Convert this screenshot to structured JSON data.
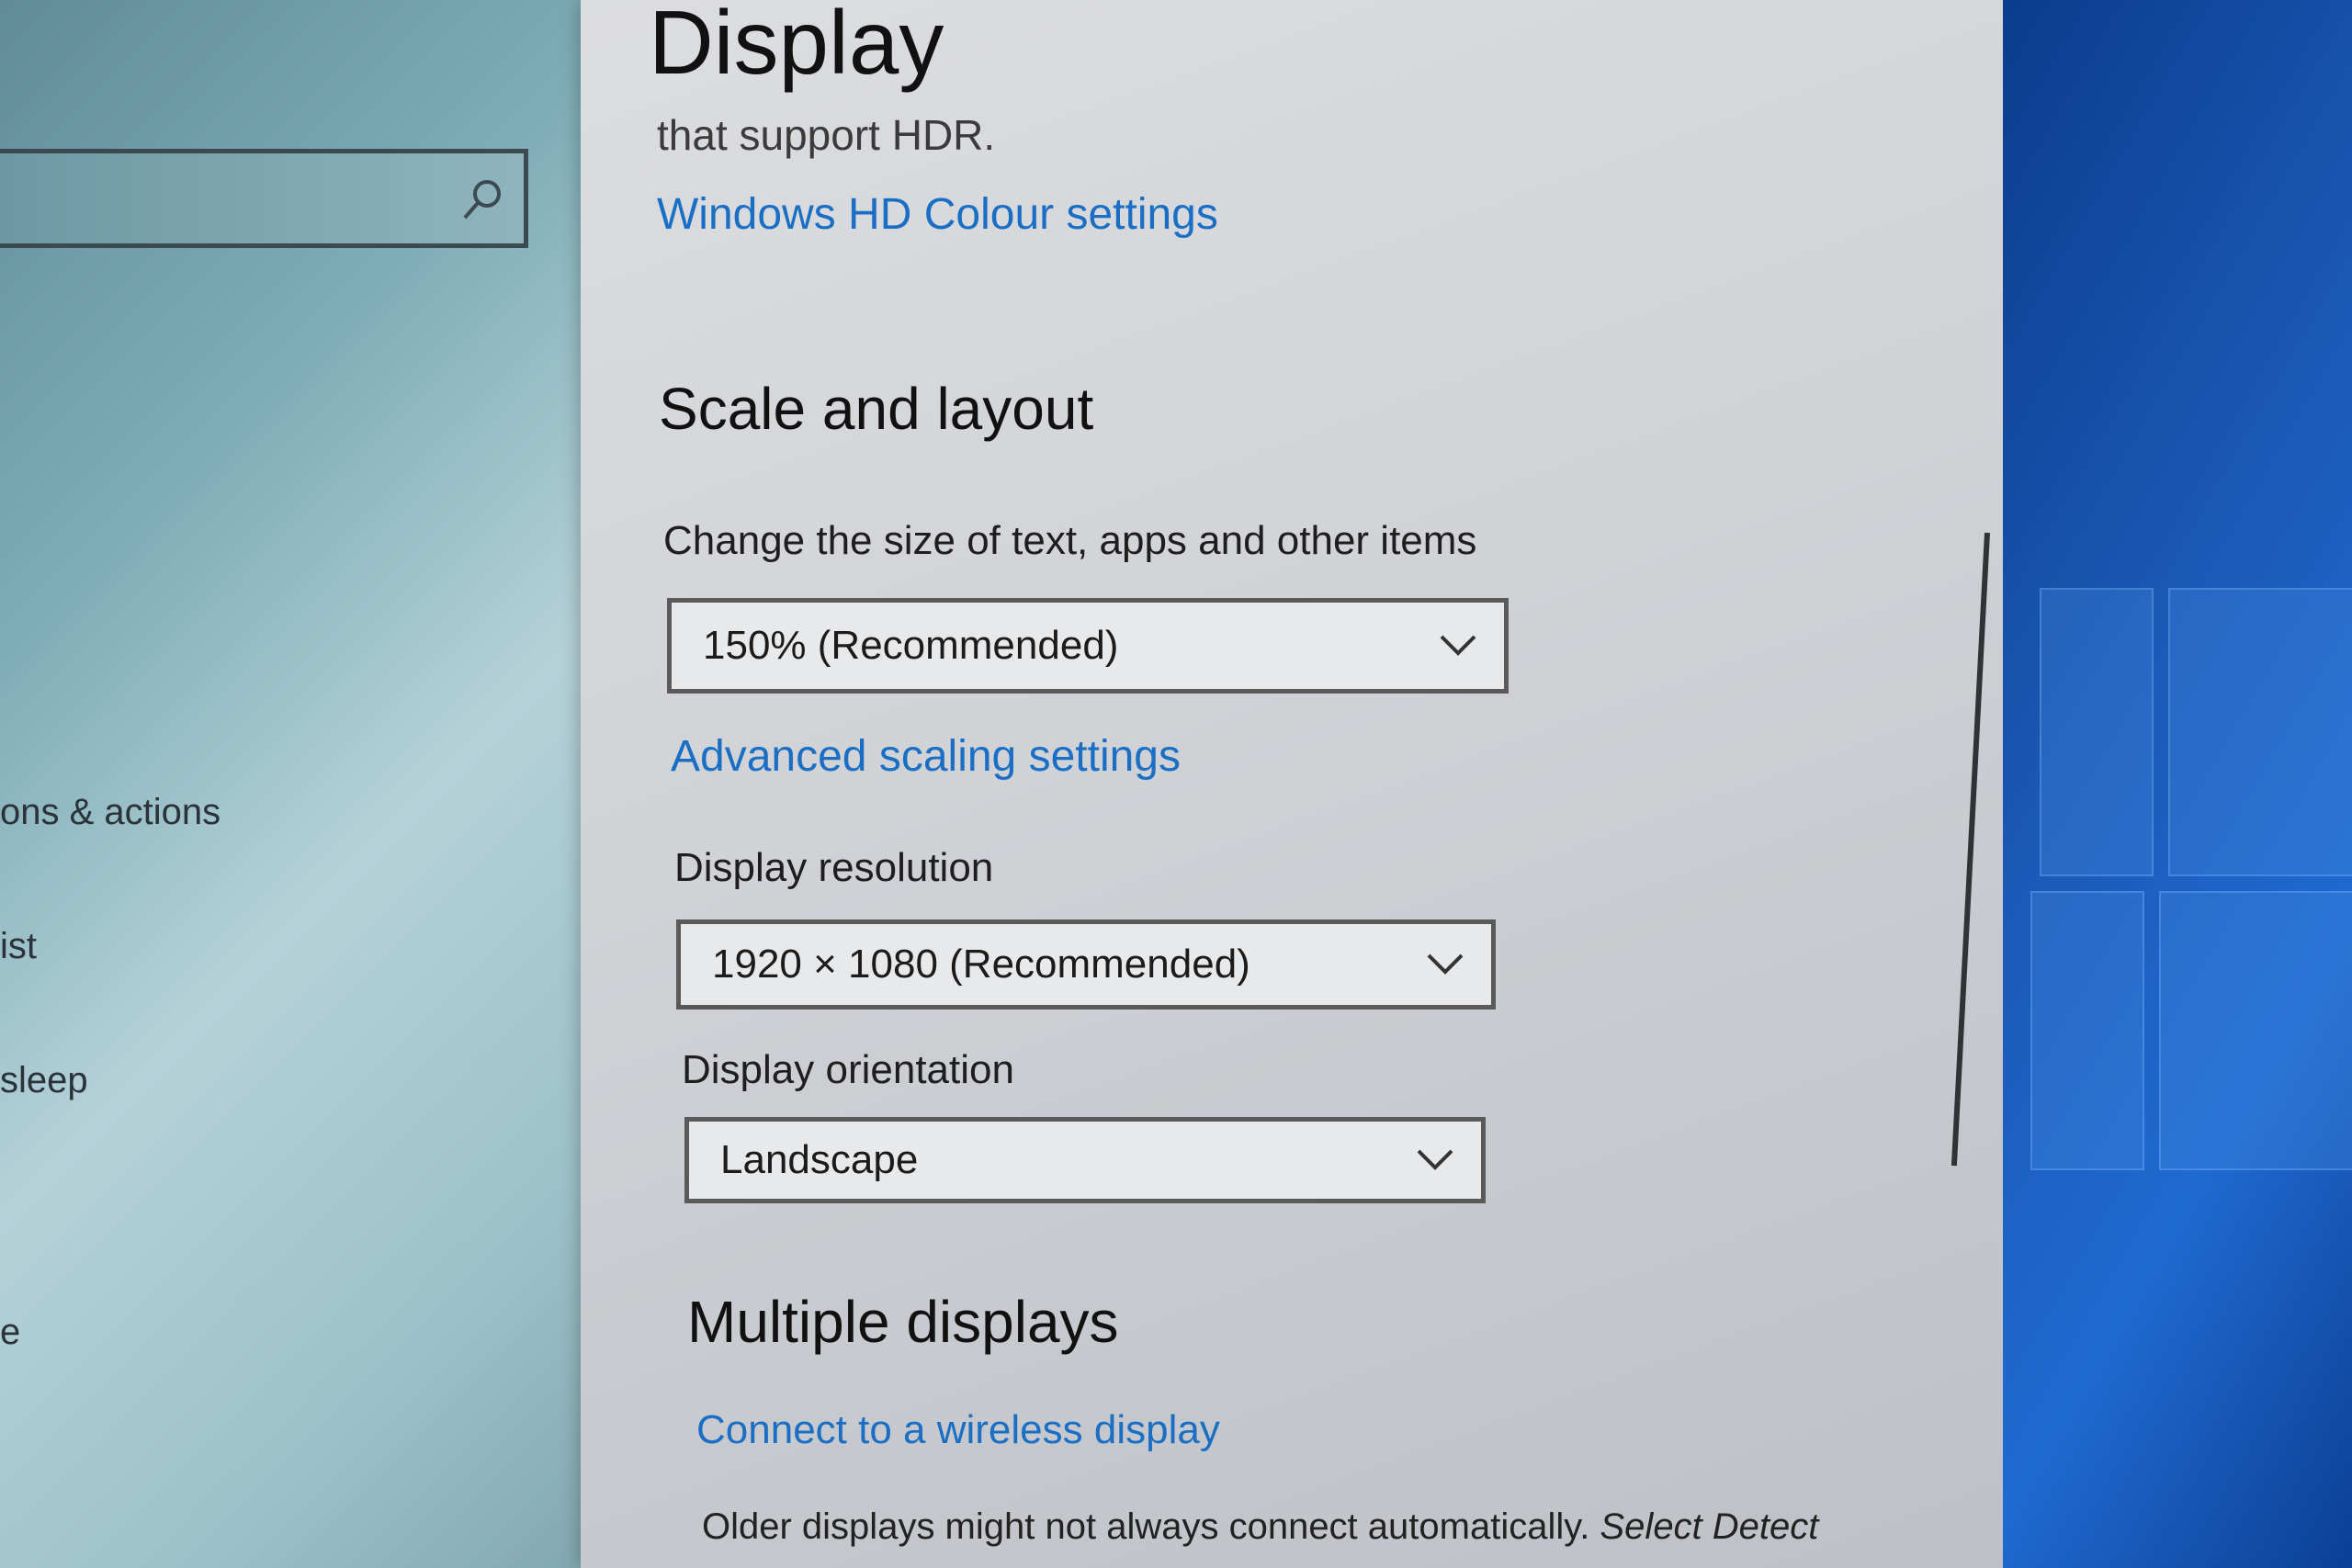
{
  "sidebar": {
    "search_placeholder": "",
    "items": [
      {
        "label": "ons & actions"
      },
      {
        "label": "ist"
      },
      {
        "label": "sleep"
      },
      {
        "label": "e"
      }
    ]
  },
  "page": {
    "title": "Display",
    "hdr_text": "that support HDR.",
    "hd_colour_link": "Windows HD Colour settings"
  },
  "scale_layout": {
    "heading": "Scale and layout",
    "size_label": "Change the size of text, apps and other items",
    "size_value": "150% (Recommended)",
    "advanced_link": "Advanced scaling settings",
    "resolution_label": "Display resolution",
    "resolution_value": "1920 × 1080 (Recommended)",
    "orientation_label": "Display orientation",
    "orientation_value": "Landscape"
  },
  "multiple_displays": {
    "heading": "Multiple displays",
    "wireless_link": "Connect to a wireless display",
    "older_text": "Older displays might not always connect automatically.",
    "select_detect": "Select Detect"
  },
  "colors": {
    "link": "#1a6fc4",
    "desktop": "#1a58b5"
  }
}
